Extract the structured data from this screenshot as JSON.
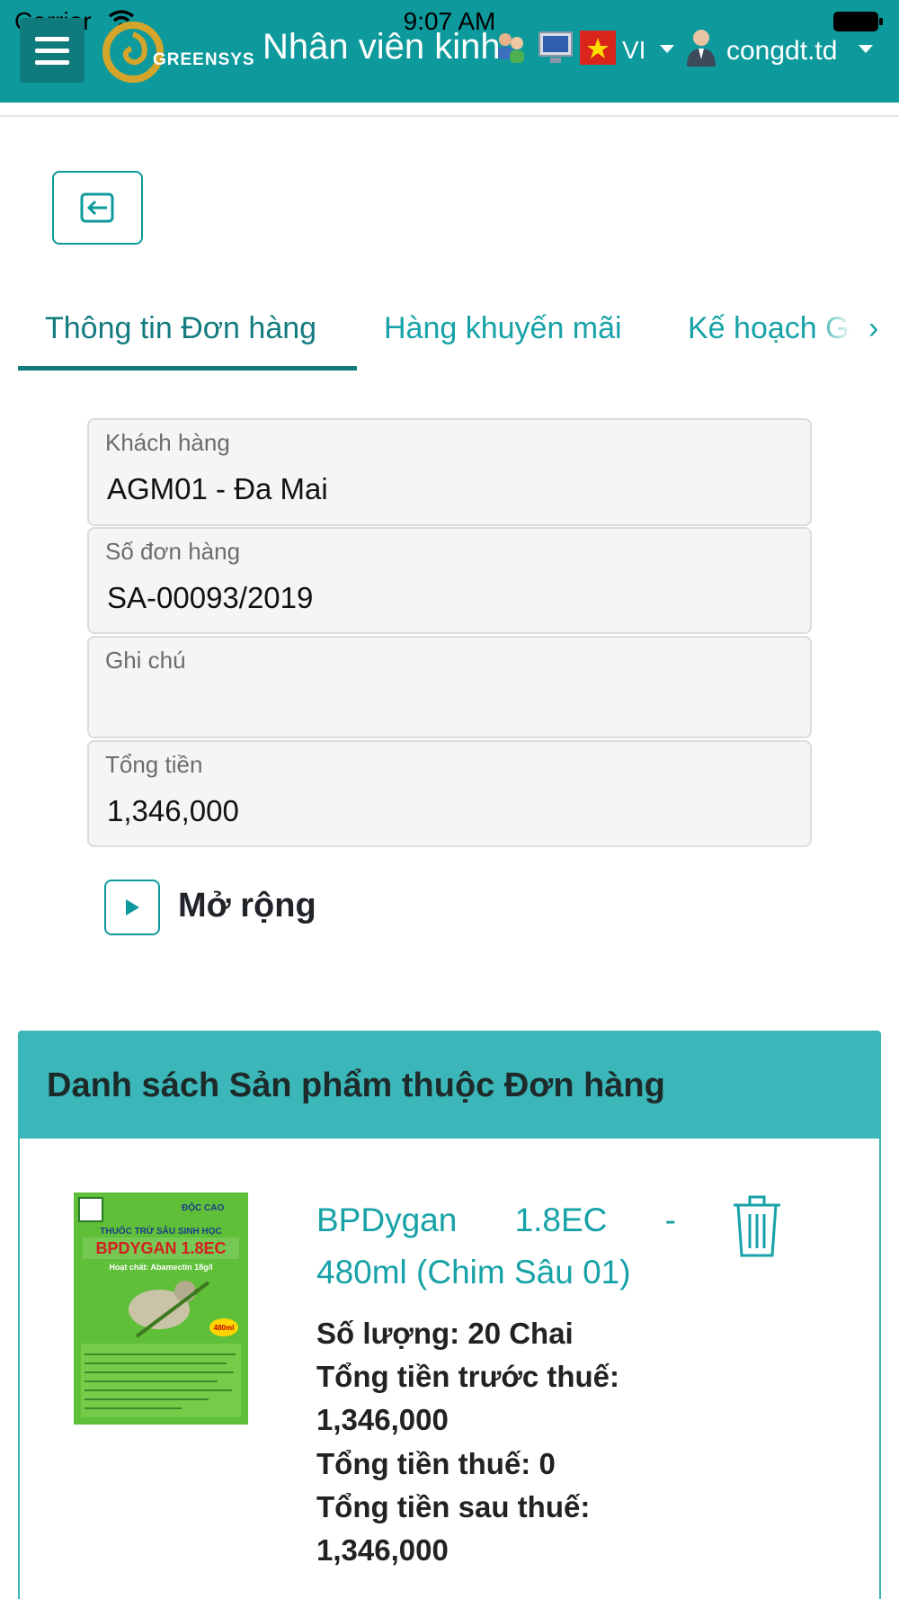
{
  "status_bar": {
    "carrier": "Carrier",
    "time": "9:07 AM"
  },
  "header": {
    "logo_text": "GREENSYS",
    "title": "Nhân viên kinh doanh",
    "language": "VI",
    "username": "congdt.td"
  },
  "tabs": [
    {
      "label": "Thông tin Đơn hàng",
      "active": true
    },
    {
      "label": "Hàng khuyến mãi",
      "active": false
    },
    {
      "label": "Kế hoạch Gi",
      "active": false
    }
  ],
  "fields": {
    "customer": {
      "label": "Khách hàng",
      "value": "AGM01 - Đa Mai"
    },
    "order_number": {
      "label": "Số đơn hàng",
      "value": "SA-00093/2019"
    },
    "note": {
      "label": "Ghi chú",
      "value": ""
    },
    "total": {
      "label": "Tổng tiền",
      "value": "1,346,000"
    }
  },
  "expand_label": "Mở rộng",
  "product_list": {
    "title": "Danh sách Sản phẩm thuộc Đơn hàng",
    "items": [
      {
        "name_line1_a": "BPDygan",
        "name_line1_b": "1.8EC",
        "name_line1_c": "-",
        "name_line2": "480ml (Chim Sâu 01)",
        "quantity": "Số lượng: 20 Chai",
        "pretax_label": "Tổng tiền trước thuế:",
        "pretax_value": "1,346,000",
        "tax": "Tổng tiền thuế: 0",
        "aftertax_label": "Tổng tiền sau thuế:",
        "aftertax_value": "1,346,000",
        "image": {
          "brand": "ĐỘC CAO",
          "subtitle": "THUỐC TRỪ SÂU SINH HỌC",
          "product": "BPDYGAN 1.8EC",
          "ingredient": "Hoạt chất: Abamectin 18g/l",
          "volume": "480ml"
        }
      }
    ]
  },
  "colors": {
    "primary": "#0e9a9c",
    "panel_header": "#3bb7b9",
    "link": "#17a2a7"
  }
}
